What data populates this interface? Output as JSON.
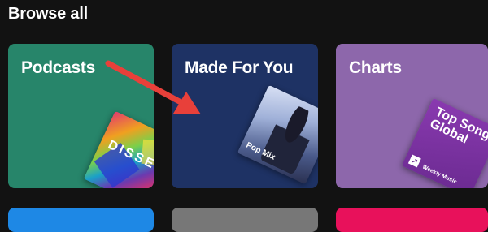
{
  "section": {
    "title": "Browse all"
  },
  "cards": [
    {
      "label": "Podcasts",
      "color": "#27856a",
      "art_text": "DISSECT"
    },
    {
      "label": "Made For You",
      "color": "#1e3264",
      "art_text": "Pop Mix"
    },
    {
      "label": "Charts",
      "color": "#8d67ab",
      "art_text": "Top Songs Global",
      "art_sub": "Weekly Music"
    }
  ],
  "bottom_cards": [
    {
      "color": "#1e88e5"
    },
    {
      "color": "#777777"
    },
    {
      "color": "#e8115b"
    }
  ],
  "annotation": {
    "arrow_color": "#e8403a"
  }
}
